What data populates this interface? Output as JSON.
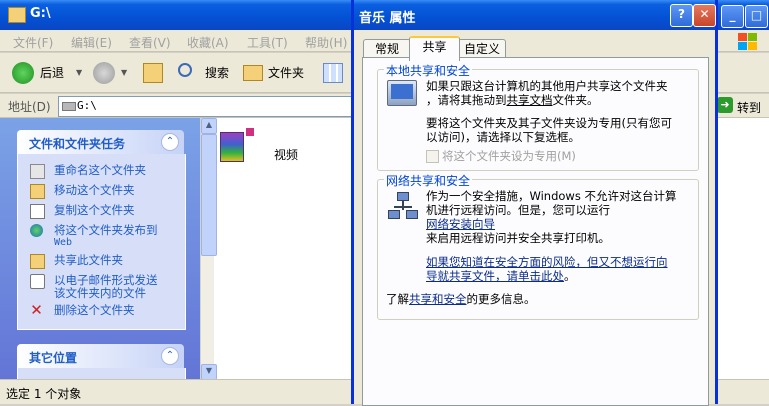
{
  "explorer": {
    "title": "G:\\",
    "menus": [
      "文件(F)",
      "编辑(E)",
      "查看(V)",
      "收藏(A)",
      "工具(T)",
      "帮助(H)"
    ],
    "toolbar": {
      "back": "后退",
      "search": "搜索",
      "folders": "文件夹"
    },
    "address": {
      "label": "地址(D)",
      "value": "G:\\",
      "go": "转到"
    },
    "tasks_panel": {
      "title": "文件和文件夹任务",
      "items": [
        {
          "icon": "rename-icon",
          "label": "重命名这个文件夹"
        },
        {
          "icon": "move-icon",
          "label": "移动这个文件夹"
        },
        {
          "icon": "copy-icon",
          "label": "复制这个文件夹"
        },
        {
          "icon": "web-publish-icon",
          "label": "将这个文件夹发布到",
          "label2": "Web"
        },
        {
          "icon": "share-icon",
          "label": "共享此文件夹"
        },
        {
          "icon": "email-icon",
          "label": "以电子邮件形式发送",
          "label2": "该文件夹内的文件"
        },
        {
          "icon": "delete-icon",
          "label": "删除这个文件夹"
        }
      ]
    },
    "other_places": {
      "title": "其它位置"
    },
    "content": {
      "items": [
        {
          "icon": "folder-icon",
          "label": "视频"
        }
      ]
    },
    "status": "选定 1 个对象"
  },
  "dialog": {
    "title": "音乐 属性",
    "tabs": [
      "常规",
      "共享",
      "自定义"
    ],
    "active_tab": "共享",
    "local": {
      "title": "本地共享和安全",
      "line1": "如果只跟这台计算机的其他用户共享这个文件夹",
      "line2a": "，请将其拖动到",
      "line2_link": "共享文档",
      "line2b": "文件夹。",
      "line3": "要将这个文件夹及其子文件夹设为专用(只有您可",
      "line4": "以访问)，请选择以下复选框。",
      "checkbox": "将这个文件夹设为专用(M)"
    },
    "network": {
      "title": "网络共享和安全",
      "line1": "作为一个安全措施，Windows 不允许对这台计算",
      "line2": "机进行远程访问。但是，您可以运行",
      "line3_link": "网络安装向导",
      "line4": "来启用远程访问并安全共享打印机。",
      "line5_link": "如果您知道在安全方面的风险，但又不想运行向",
      "line6_link": "导就共享文件，请单击此处",
      "line6_tail": "。"
    },
    "footer": {
      "prefix": "了解",
      "link": "共享和安全",
      "suffix": "的更多信息。"
    }
  },
  "colors": {
    "title_blue": "#0451d4",
    "task_link": "#215dc6",
    "group_label": "#0046d5"
  }
}
